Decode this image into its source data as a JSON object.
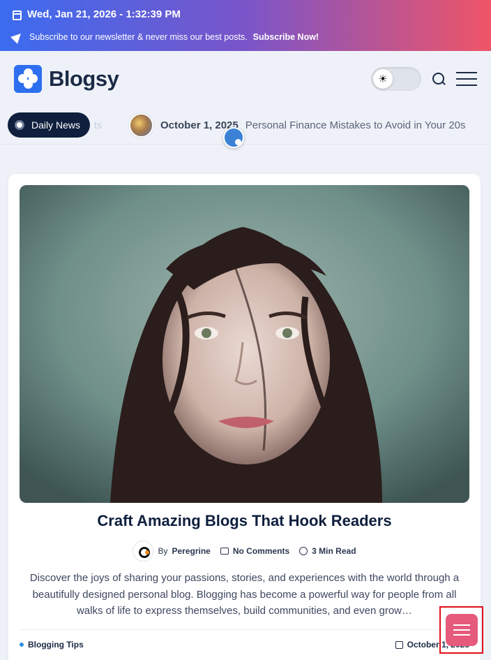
{
  "topbar": {
    "date": "Wed, Jan 21, 2026 - 1:32:39 PM",
    "subscribe_text": "Subscribe to our newsletter & never miss our best posts.",
    "subscribe_link": "Subscribe Now!"
  },
  "header": {
    "logo_text": "Blogsy",
    "theme_toggle_icon": "sun-icon"
  },
  "ticker": {
    "label": "Daily News",
    "ghost_text": "ts",
    "item": {
      "date": "October 1, 2025",
      "title": "Personal Finance Mistakes to Avoid in Your 20s"
    }
  },
  "post": {
    "title": "Craft Amazing Blogs That Hook Readers",
    "author_prefix": "By",
    "author": "Peregrine",
    "comments": "No Comments",
    "read_time": "3 Min Read",
    "excerpt": "Discover the joys of sharing your passions, stories, and experiences with the world through a beautifully designed personal blog. Blogging has become a powerful way for people from all walks of life to express themselves, build communities, and even grow…",
    "category": "Blogging Tips",
    "date": "October 1, 2025"
  },
  "colors": {
    "accent": "#2e6ff0",
    "navy": "#0f1f3d",
    "float_button": "#e65a7c"
  }
}
